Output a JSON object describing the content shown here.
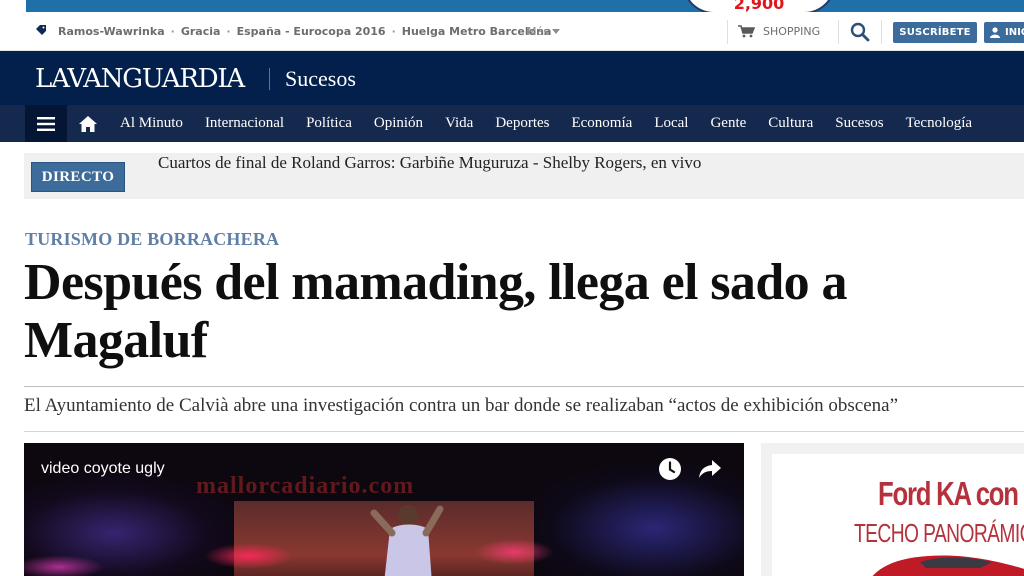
{
  "top_ad": {
    "badge_text": "2,900"
  },
  "utility": {
    "topics": [
      "Ramos-Wawrinka",
      "Gracia",
      "España - Eurocopa 2016",
      "Huelga Metro Barcelona"
    ],
    "separator": "·",
    "more_label": "Más",
    "shopping_label": "SHOPPING",
    "subscribe_label": "SUSCRÍBETE",
    "login_label": "INICIAR"
  },
  "brand": {
    "logo": "LAVANGUARDIA",
    "section": "Sucesos"
  },
  "nav": {
    "items": [
      "Al Minuto",
      "Internacional",
      "Política",
      "Opinión",
      "Vida",
      "Deportes",
      "Economía",
      "Local",
      "Gente",
      "Cultura",
      "Sucesos",
      "Tecnología"
    ]
  },
  "live": {
    "badge": "DIRECTO",
    "text": "Cuartos de final de Roland Garros: Garbiñe Muguruza - Shelby Rogers, en vivo"
  },
  "article": {
    "kicker": "TURISMO DE BORRACHERA",
    "headline": "Después del mamading, llega el sado a Magaluf",
    "summary": "El Ayuntamiento de Calvià abre una investigación contra un bar donde se realizaban “actos de exhibición obscena”"
  },
  "video": {
    "title": "video coyote ugly",
    "watermark": "mallorcadiario.com"
  },
  "ad": {
    "line1": "Ford KA con",
    "line2": "TECHO PANORÁMICO"
  },
  "colors": {
    "brand_navy": "#03204d",
    "nav_blue": "#15294f",
    "accent_blue": "#3d6c9b",
    "kicker_blue": "#5f7fa6",
    "ad_red": "#b5323c"
  }
}
